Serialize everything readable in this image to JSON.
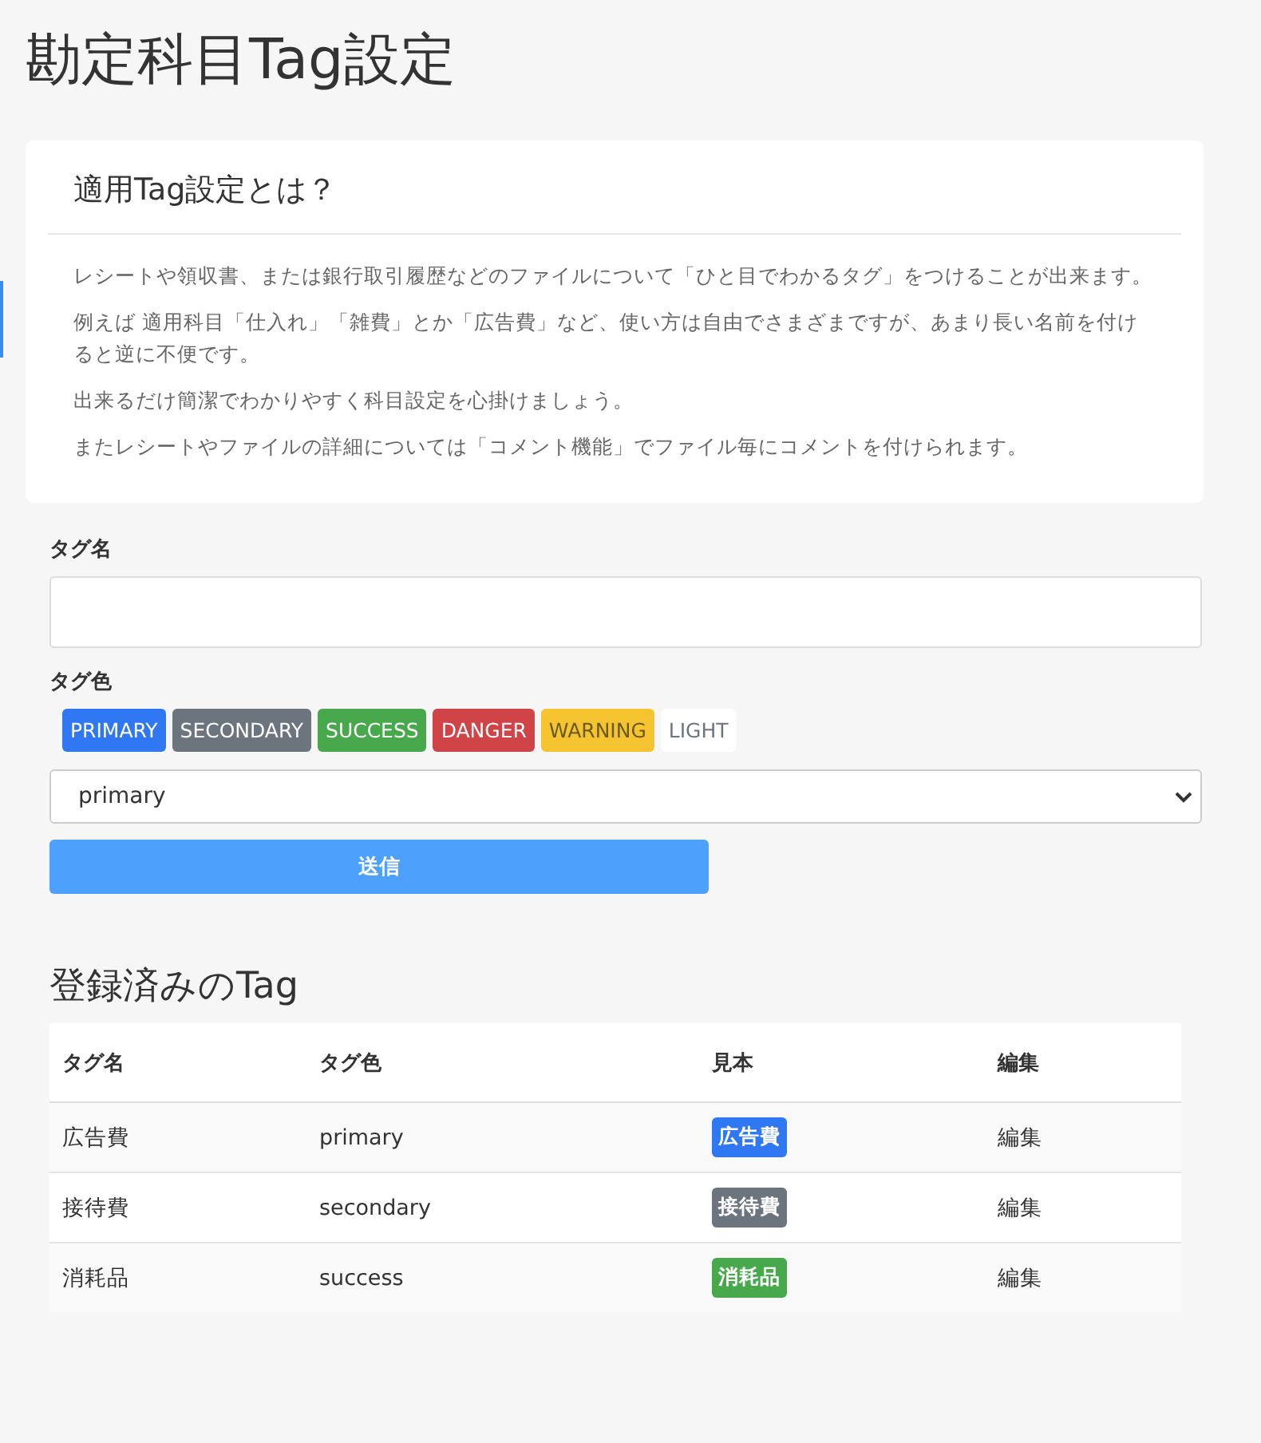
{
  "page_title": "勘定科目Tag設定",
  "info_card": {
    "title": "適用Tag設定とは？",
    "paragraphs": [
      "レシートや領収書、または銀行取引履歴などのファイルについて「ひと目でわかるタグ」をつけることが出来ます。",
      "例えば 適用科目「仕入れ」「雑費」とか「広告費」など、使い方は自由でさまざまですが、あまり長い名前を付けると逆に不便です。",
      "出来るだけ簡潔でわかりやすく科目設定を心掛けましょう。",
      "またレシートやファイルの詳細については「コメント機能」でファイル毎にコメントを付けられます。"
    ]
  },
  "form": {
    "name_label": "タグ名",
    "color_label": "タグ色",
    "palette": [
      {
        "label": "PRIMARY",
        "color": "#3077f3"
      },
      {
        "label": "SECONDARY",
        "color": "#6c757d"
      },
      {
        "label": "SUCCESS",
        "color": "#48a84c"
      },
      {
        "label": "DANGER",
        "color": "#d04448"
      },
      {
        "label": "WARNING",
        "color": "#f7c431"
      },
      {
        "label": "LIGHT",
        "color": "#ffffff"
      }
    ],
    "color_select": {
      "value": "primary"
    },
    "submit": "送信"
  },
  "registered": {
    "title": "登録済みのTag",
    "columns": [
      "タグ名",
      "タグ色",
      "見本",
      "編集"
    ],
    "rows": [
      {
        "name": "広告費",
        "color_name": "primary",
        "sample": "広告費",
        "color": "#3077f3",
        "edit": "編集"
      },
      {
        "name": "接待費",
        "color_name": "secondary",
        "sample": "接待費",
        "color": "#6c757d",
        "edit": "編集"
      },
      {
        "name": "消耗品",
        "color_name": "success",
        "sample": "消耗品",
        "color": "#48a84c",
        "edit": "編集"
      }
    ]
  }
}
